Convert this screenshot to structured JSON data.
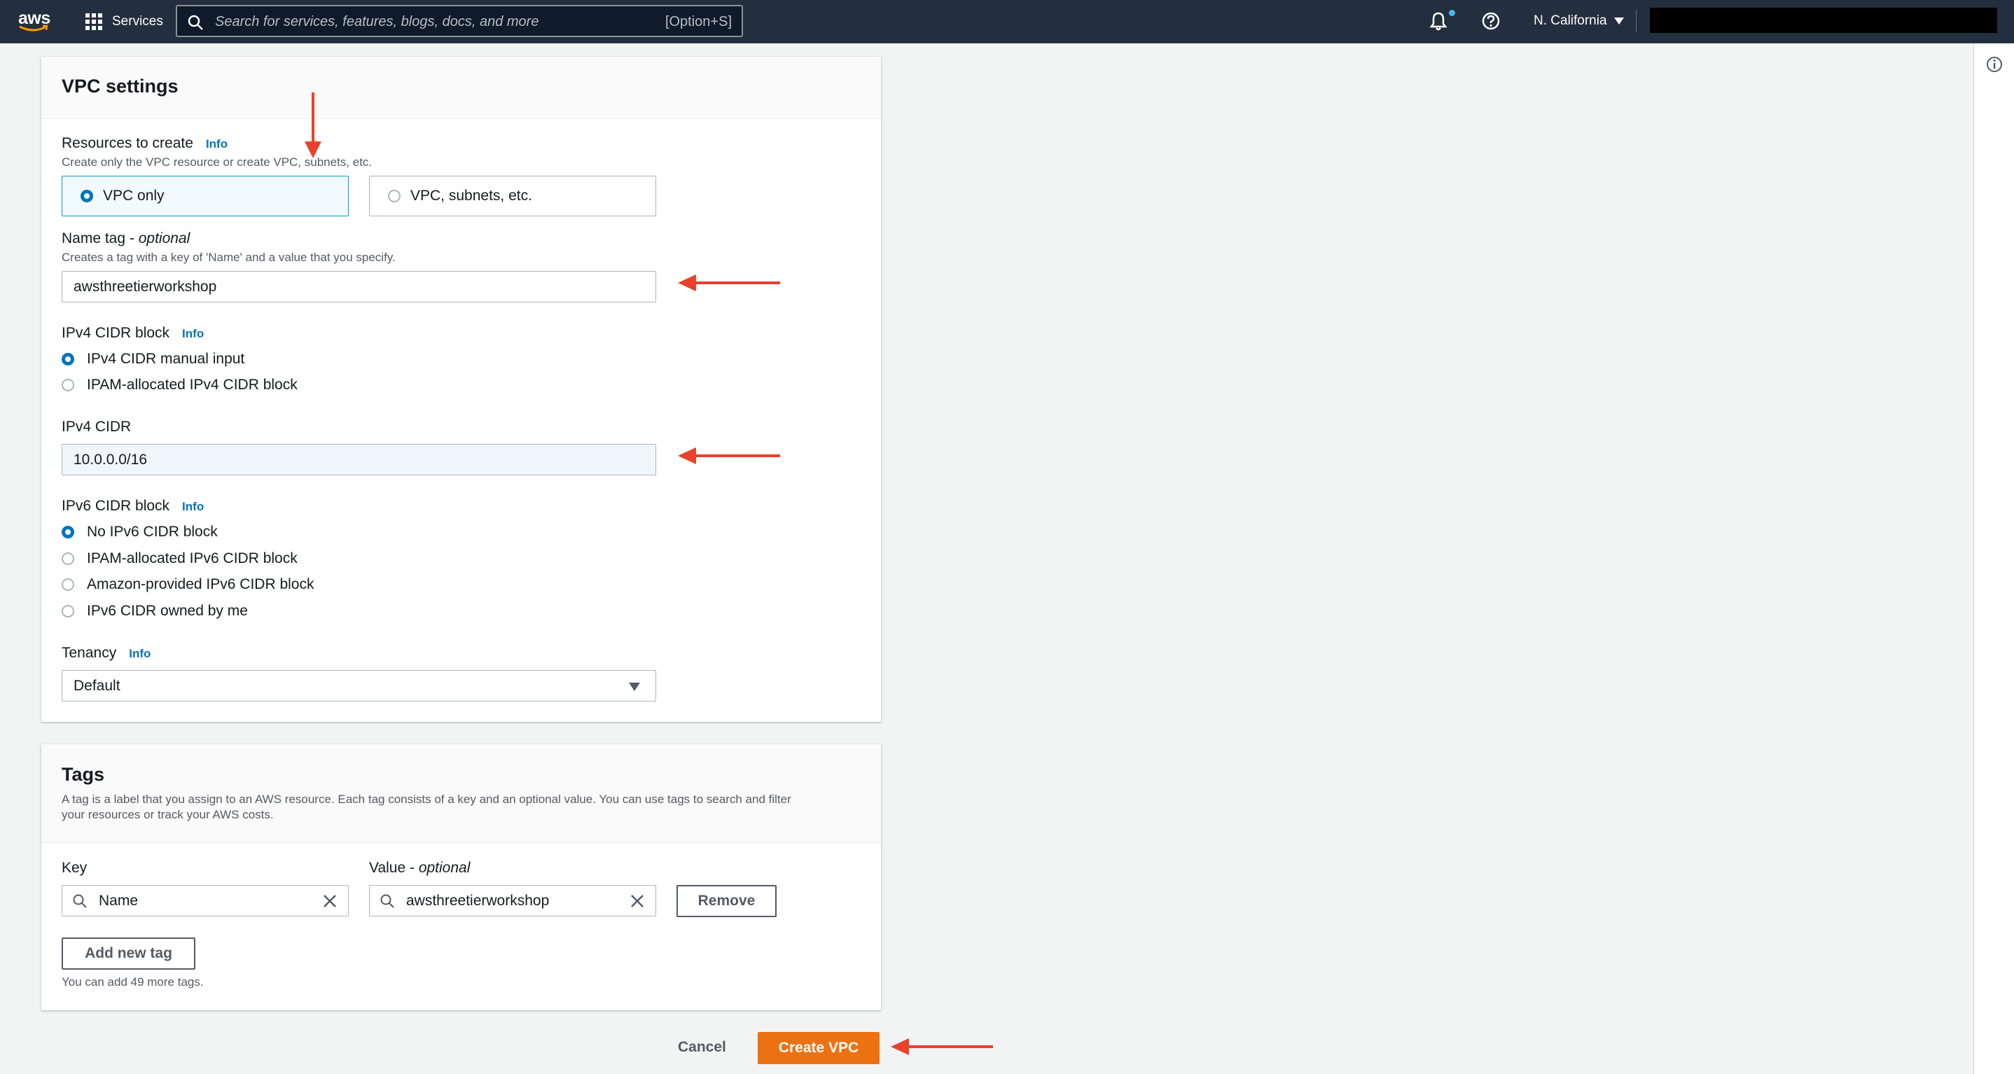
{
  "nav": {
    "logo": "aws",
    "services_label": "Services",
    "search_placeholder": "Search for services, features, blogs, docs, and more",
    "search_shortcut": "[Option+S]",
    "region": "N. California",
    "icons": [
      "grid-icon",
      "search-icon",
      "bell-icon",
      "help-icon",
      "caret-down-icon"
    ]
  },
  "vpc_settings": {
    "title": "VPC settings",
    "resources": {
      "label": "Resources to create",
      "info": "Info",
      "description": "Create only the VPC resource or create VPC, subnets, etc.",
      "options": [
        "VPC only",
        "VPC, subnets, etc."
      ],
      "selected": "VPC only"
    },
    "name_tag": {
      "label": "Name tag - ",
      "optional": "optional",
      "description": "Creates a tag with a key of 'Name' and a value that you specify.",
      "value": "awsthreetierworkshop"
    },
    "ipv4_block": {
      "label": "IPv4 CIDR block",
      "info": "Info",
      "options": [
        "IPv4 CIDR manual input",
        "IPAM-allocated IPv4 CIDR block"
      ],
      "selected": "IPv4 CIDR manual input"
    },
    "ipv4_cidr": {
      "label": "IPv4 CIDR",
      "value": "10.0.0.0/16"
    },
    "ipv6_block": {
      "label": "IPv6 CIDR block",
      "info": "Info",
      "options": [
        "No IPv6 CIDR block",
        "IPAM-allocated IPv6 CIDR block",
        "Amazon-provided IPv6 CIDR block",
        "IPv6 CIDR owned by me"
      ],
      "selected": "No IPv6 CIDR block"
    },
    "tenancy": {
      "label": "Tenancy",
      "info": "Info",
      "value": "Default"
    }
  },
  "tags": {
    "title": "Tags",
    "description_line1": "A tag is a label that you assign to an AWS resource. Each tag consists of a key and an optional value. You can use tags to search and filter",
    "description_line2": "your resources or track your AWS costs.",
    "key_label": "Key",
    "value_label": "Value - ",
    "value_optional": "optional",
    "key_value": "Name",
    "value_value": "awsthreetierworkshop",
    "remove_label": "Remove",
    "add_label": "Add new tag",
    "limit_text": "You can add 49 more tags."
  },
  "footer": {
    "cancel_label": "Cancel",
    "create_label": "Create VPC"
  },
  "colors": {
    "nav_bg": "#232f3e",
    "accent": "#0073bb",
    "primary": "#ec7211",
    "annotation_arrow": "#e8412c"
  }
}
